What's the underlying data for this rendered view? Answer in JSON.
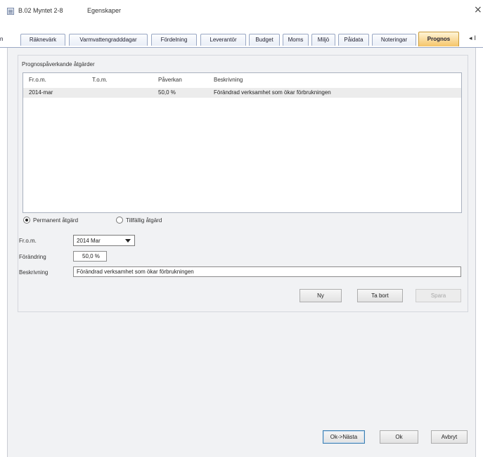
{
  "window": {
    "title": "B.02 Myntet 2-8",
    "subtitle": "Egenskaper",
    "close_glyph": "×"
  },
  "tabs": {
    "stub": "n",
    "items": [
      {
        "label": "Räknevärk"
      },
      {
        "label": "Varmvattengradddagar"
      },
      {
        "label": "Fördelning"
      },
      {
        "label": "Leverantör"
      },
      {
        "label": "Budget"
      },
      {
        "label": "Moms"
      },
      {
        "label": "Miljö"
      },
      {
        "label": "Påidata"
      },
      {
        "label": "Noteringar"
      },
      {
        "label": "Prognos",
        "active": true
      }
    ],
    "scroll_glyph": "◂ I"
  },
  "group": {
    "label": "Prognospåverkande åtgärder"
  },
  "list": {
    "columns": [
      "Fr.o.m.",
      "T.o.m.",
      "Påverkan",
      "Beskrivning"
    ],
    "rows": [
      {
        "from": "2014-mar",
        "to": "",
        "impact": "50,0 %",
        "description": "Förändrad verksamhet som ökar förbrukningen"
      }
    ]
  },
  "form": {
    "radio_permanent": "Permanent åtgärd",
    "radio_temporary": "Tillfällig åtgärd",
    "from_label": "Fr.o.m.",
    "from_value": "2014 Mar",
    "change_label": "Förändring",
    "change_value": "50,0 %",
    "description_label": "Beskrivning",
    "description_value": "Förändrad verksamhet som ökar förbrukningen"
  },
  "buttons": {
    "new": "Ny",
    "delete": "Ta bort",
    "save": "Spara"
  },
  "footer": {
    "ok_next": "Ok->Nästa",
    "ok": "Ok",
    "cancel": "Avbryt"
  }
}
